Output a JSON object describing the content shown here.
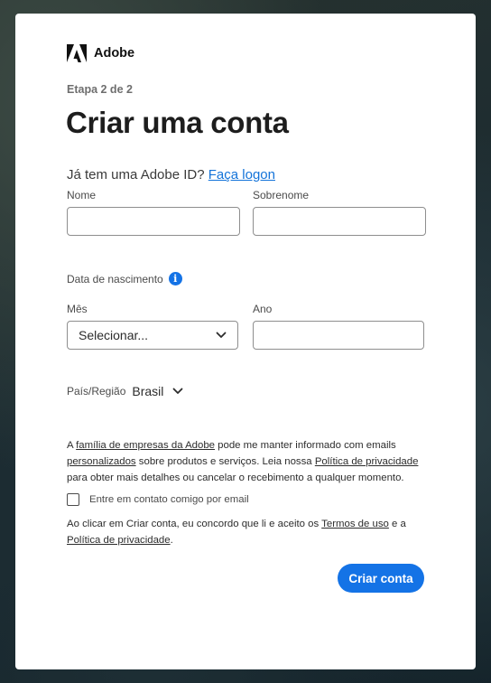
{
  "brand": {
    "name": "Adobe"
  },
  "step": "Etapa 2 de 2",
  "title": "Criar uma conta",
  "signin": {
    "prompt": "Já tem uma Adobe ID?",
    "link": "Faça logon"
  },
  "form": {
    "first_name": {
      "label": "Nome",
      "value": ""
    },
    "last_name": {
      "label": "Sobrenome",
      "value": ""
    },
    "birth": {
      "label": "Data de nascimento",
      "month": {
        "label": "Mês",
        "value": "Selecionar..."
      },
      "year": {
        "label": "Ano",
        "value": ""
      }
    },
    "country": {
      "label": "País/Região",
      "value": "Brasil"
    }
  },
  "consent": {
    "t1": "A ",
    "link_family": "família de empresas da Adobe",
    "t2": " pode me manter informado com emails ",
    "link_personalized": "personalizados",
    "t3": " sobre produtos e serviços. Leia nossa ",
    "link_privacy": "Política de privacidade",
    "t4": " para obter mais detalhes ou cancelar o recebimento a qualquer momento."
  },
  "contact_checkbox": {
    "label": "Entre em contato comigo por email",
    "checked": false
  },
  "terms": {
    "t1": "Ao clicar em Criar conta, eu concordo que li e aceito os ",
    "link_terms": "Termos de uso",
    "t2": " e a ",
    "link_privacy": "Política de privacidade",
    "t3": "."
  },
  "submit_label": "Criar conta",
  "colors": {
    "accent": "#1473e6",
    "link": "#1373d9"
  },
  "icons": {
    "logo": "adobe-logo",
    "info": "info-icon",
    "chevron": "chevron-down-icon",
    "checkbox": "checkbox"
  }
}
